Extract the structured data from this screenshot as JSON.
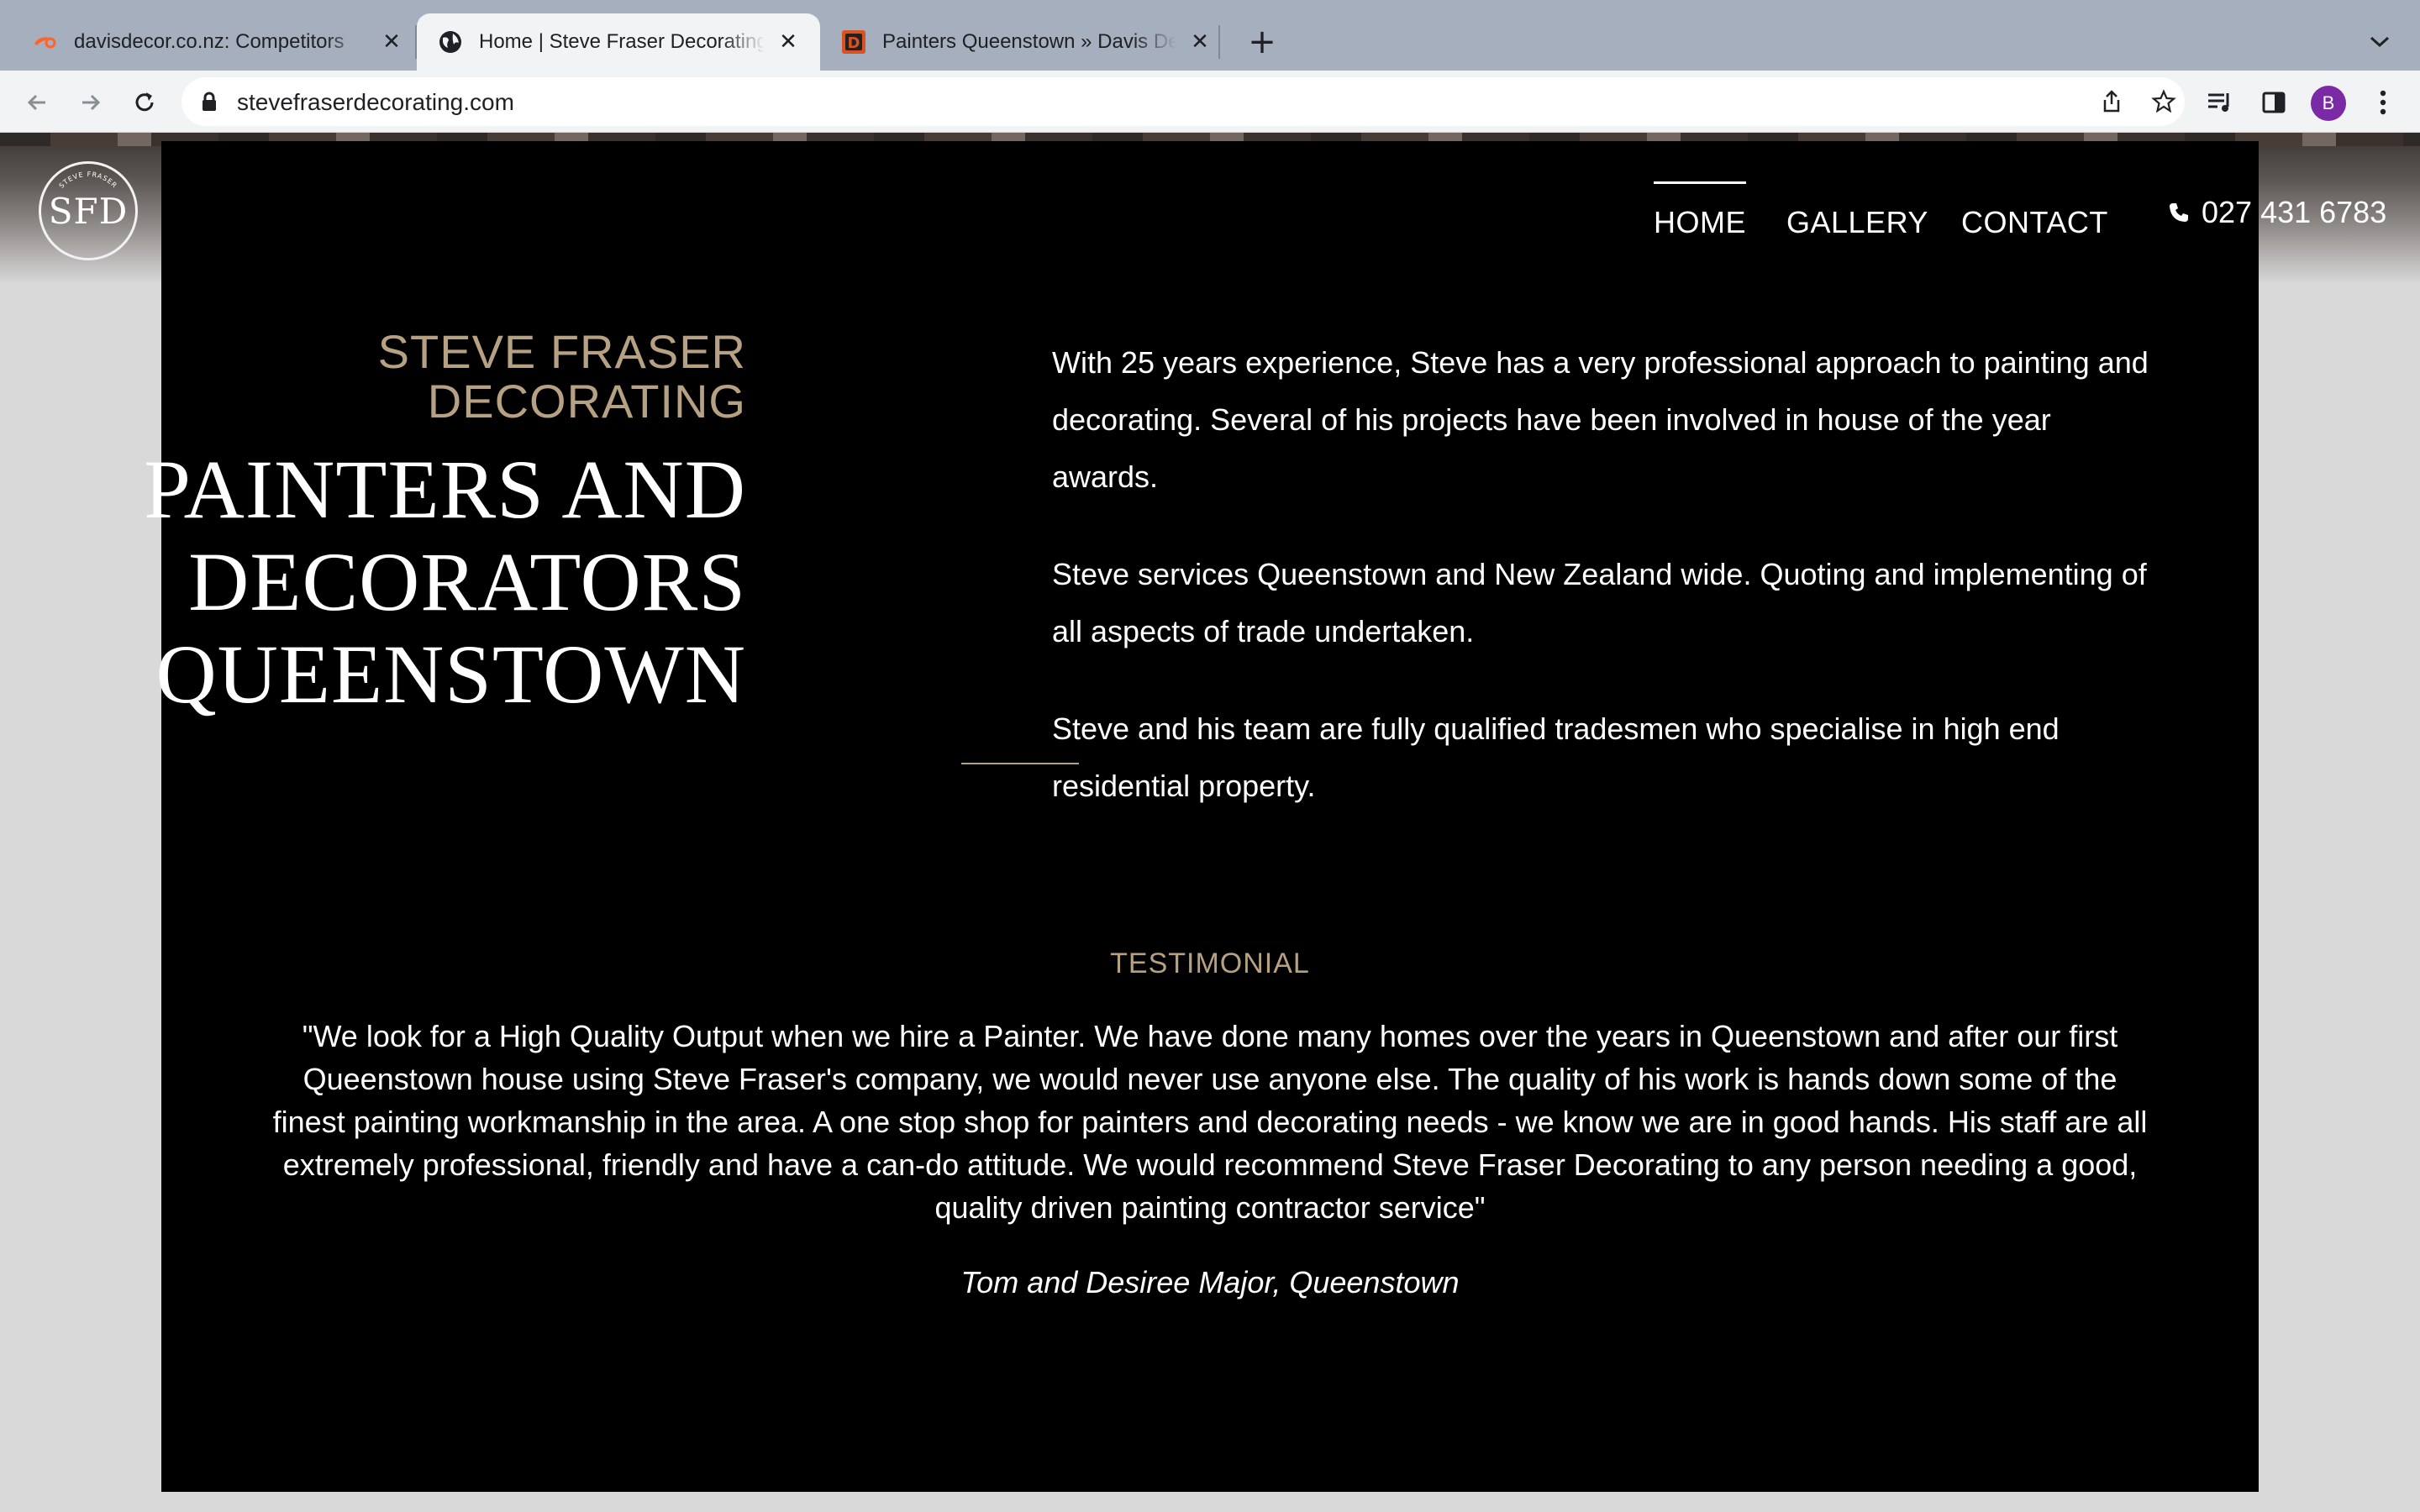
{
  "browser": {
    "tabs": [
      {
        "title": "davisdecor.co.nz: Competitors",
        "icon": "semrush-icon",
        "active": false
      },
      {
        "title": "Home | Steve Fraser Decorating",
        "icon": "globe-icon",
        "active": true
      },
      {
        "title": "Painters Queenstown » Davis Decor",
        "icon": "d-logo-icon",
        "active": false
      }
    ],
    "new_tab_label": "+",
    "url": "stevefraserdecorating.com",
    "profile_initial": "B",
    "colors": {
      "tabstrip": "#a6afbd",
      "toolbar": "#f1f3f4",
      "avatar": "#7b2aa6"
    }
  },
  "site": {
    "logo_text": "SFD",
    "logo_ring_text": "STEVE FRASER DECORATING",
    "nav": [
      {
        "label": "HOME",
        "current": true
      },
      {
        "label": "GALLERY",
        "current": false
      },
      {
        "label": "CONTACT",
        "current": false
      }
    ],
    "phone": "027 431 6783",
    "brand_line1": "STEVE FRASER",
    "brand_line2": "DECORATING",
    "headline_line1": "PAINTERS AND",
    "headline_line2": "DECORATORS",
    "headline_line3": "QUEENSTOWN",
    "about": [
      "With 25 years experience, Steve has a very professional approach to painting and decorating. Several of his projects have been involved in house of the year awards.",
      "Steve services Queenstown and New Zealand wide. Quoting and implementing of all aspects of trade undertaken.",
      "Steve and his team are fully qualified tradesmen who specialise in high end residential property."
    ],
    "testimonial_label": "TESTIMONIAL",
    "testimonial_quote": "\"We look for a High Quality Output when we hire a Painter. We have done many homes over the years in Queenstown and after our first Queenstown house using Steve Fraser's company, we would never use anyone else. The quality of his work is hands down some of the finest painting workmanship in the area. A one stop shop for painters and decorating needs - we know we are in good hands. His staff are all extremely professional, friendly and have a can-do attitude. We would recommend Steve Fraser Decorating to any person needing a good, quality driven painting contractor service\"",
    "testimonial_author": "Tom and Desiree Major, Queenstown",
    "colors": {
      "panel": "#000000",
      "accent": "#b6a182",
      "text": "#ffffff",
      "page_bg": "#d9d9d9"
    }
  }
}
